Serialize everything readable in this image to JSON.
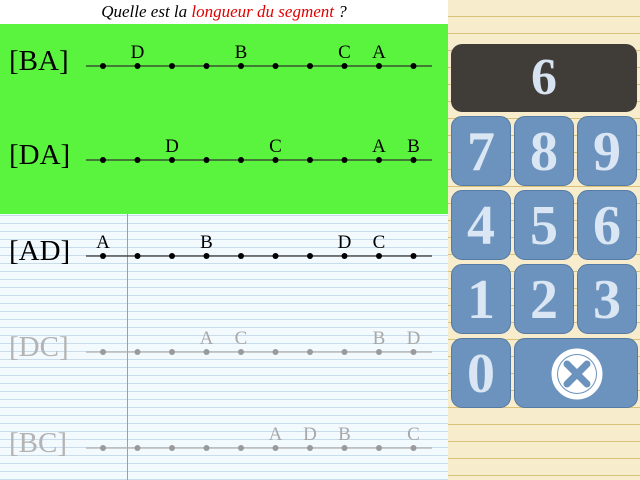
{
  "header": {
    "prefix": "Quelle est la ",
    "accent": "longueur du segment",
    "suffix": " ?"
  },
  "rows": [
    {
      "label": "[BA]",
      "state": "answered",
      "letters": [
        [
          "D",
          1
        ],
        [
          "B",
          4
        ],
        [
          "C",
          7
        ],
        [
          "A",
          8
        ]
      ]
    },
    {
      "label": "[DA]",
      "state": "answered",
      "letters": [
        [
          "D",
          2
        ],
        [
          "C",
          5
        ],
        [
          "A",
          8
        ],
        [
          "B",
          9
        ]
      ]
    },
    {
      "label": "[AD]",
      "state": "current",
      "letters": [
        [
          "A",
          0
        ],
        [
          "B",
          3
        ],
        [
          "D",
          7
        ],
        [
          "C",
          8
        ]
      ]
    },
    {
      "label": "[DC]",
      "state": "pending",
      "letters": [
        [
          "A",
          3
        ],
        [
          "C",
          4
        ],
        [
          "B",
          8
        ],
        [
          "D",
          9
        ]
      ]
    },
    {
      "label": "[BC]",
      "state": "pending",
      "letters": [
        [
          "A",
          5
        ],
        [
          "D",
          6
        ],
        [
          "B",
          7
        ],
        [
          "C",
          9
        ]
      ]
    }
  ],
  "keypad": {
    "display": "6",
    "keys": [
      "7",
      "8",
      "9",
      "4",
      "5",
      "6",
      "1",
      "2",
      "3",
      "0"
    ],
    "clear_icon": "clear-x-icon"
  },
  "colors": {
    "answered_bg": "#5af43e",
    "accent": "#e00000",
    "display_bg": "#403d39",
    "key_bg": "#6b93bd"
  }
}
